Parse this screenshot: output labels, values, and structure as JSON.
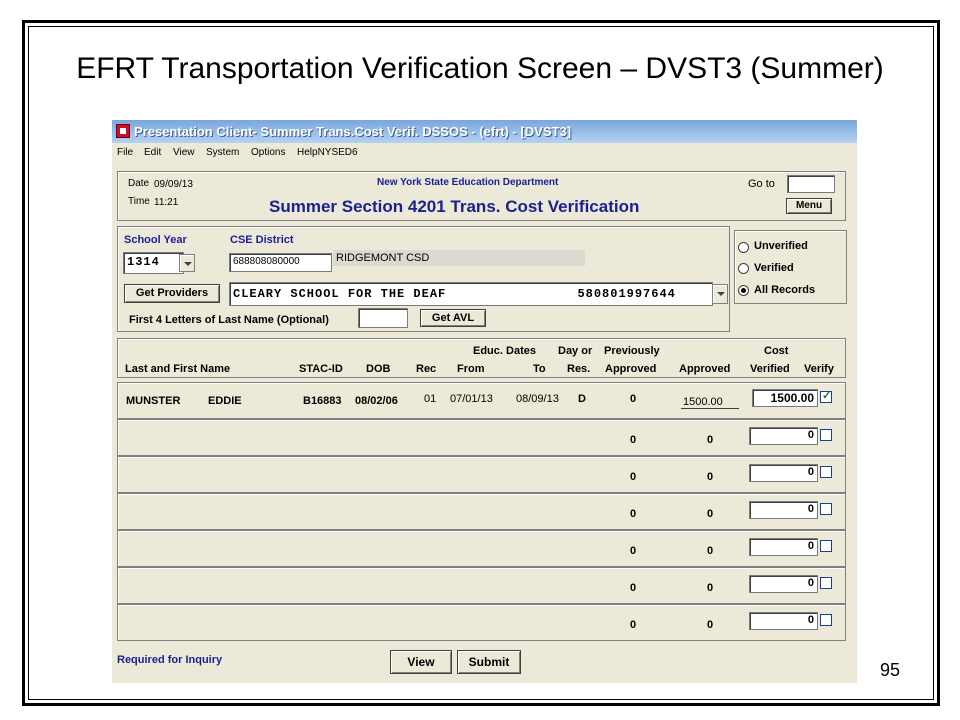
{
  "slide": {
    "title": "EFRT Transportation Verification Screen – DVST3 (Summer)",
    "page_number": "95"
  },
  "window": {
    "title": "Presentation Client- Summer Trans.Cost Verif. DSSOS - (efrt) - [DVST3]",
    "menu": [
      "File",
      "Edit",
      "View",
      "System",
      "Options",
      "HelpNYSED6"
    ]
  },
  "header": {
    "date_label": "Date",
    "date_value": "09/09/13",
    "time_label": "Time",
    "time_value": "11:21",
    "department": "New York State Education Department",
    "screen_title": "Summer Section 4201 Trans. Cost Verification",
    "goto_label": "Go to",
    "goto_value": "",
    "menu_button": "Menu"
  },
  "filters": {
    "school_year_label": "School Year",
    "school_year_value": "1314",
    "cse_district_label": "CSE District",
    "cse_district_code": "688808080000",
    "cse_district_name": "RIDGEMONT CSD",
    "get_providers_button": "Get Providers",
    "provider_value": "CLEARY SCHOOL FOR THE DEAF                580801997644",
    "last_name_label": "First 4 Letters of Last Name (Optional)",
    "last_name_value": "",
    "get_avl_button": "Get AVL",
    "record_filter": [
      {
        "label": "Unverified",
        "selected": false
      },
      {
        "label": "Verified",
        "selected": false
      },
      {
        "label": "All Records",
        "selected": true
      }
    ]
  },
  "table": {
    "group_headers": {
      "educ_dates": "Educ. Dates",
      "day_or": "Day or",
      "previously": "Previously",
      "cost": "Cost"
    },
    "columns": {
      "name": "Last and First Name",
      "stac_id": "STAC-ID",
      "dob": "DOB",
      "rec": "Rec",
      "from": "From",
      "to": "To",
      "res": "Res.",
      "prev_approved": "Approved",
      "approved": "Approved",
      "verified": "Verified",
      "verify": "Verify"
    },
    "rows": [
      {
        "last": "MUNSTER",
        "first": "EDDIE",
        "stac_id": "B16883",
        "dob": "08/02/06",
        "rec": "01",
        "from": "07/01/13",
        "to": "08/09/13",
        "res": "D",
        "prev_approved": "0",
        "approved": "1500.00",
        "cost_verified": "1500.00",
        "verify": true
      },
      {
        "last": "",
        "first": "",
        "stac_id": "",
        "dob": "",
        "rec": "",
        "from": "",
        "to": "",
        "res": "",
        "prev_approved": "0",
        "approved": "0",
        "cost_verified": "0",
        "verify": false
      },
      {
        "last": "",
        "first": "",
        "stac_id": "",
        "dob": "",
        "rec": "",
        "from": "",
        "to": "",
        "res": "",
        "prev_approved": "0",
        "approved": "0",
        "cost_verified": "0",
        "verify": false
      },
      {
        "last": "",
        "first": "",
        "stac_id": "",
        "dob": "",
        "rec": "",
        "from": "",
        "to": "",
        "res": "",
        "prev_approved": "0",
        "approved": "0",
        "cost_verified": "0",
        "verify": false
      },
      {
        "last": "",
        "first": "",
        "stac_id": "",
        "dob": "",
        "rec": "",
        "from": "",
        "to": "",
        "res": "",
        "prev_approved": "0",
        "approved": "0",
        "cost_verified": "0",
        "verify": false
      },
      {
        "last": "",
        "first": "",
        "stac_id": "",
        "dob": "",
        "rec": "",
        "from": "",
        "to": "",
        "res": "",
        "prev_approved": "0",
        "approved": "0",
        "cost_verified": "0",
        "verify": false
      },
      {
        "last": "",
        "first": "",
        "stac_id": "",
        "dob": "",
        "rec": "",
        "from": "",
        "to": "",
        "res": "",
        "prev_approved": "0",
        "approved": "0",
        "cost_verified": "0",
        "verify": false
      }
    ]
  },
  "footer": {
    "required_note": "Required for Inquiry",
    "view_button": "View",
    "submit_button": "Submit"
  },
  "colors": {
    "title_blue": "#1b1f8f",
    "window_bg": "#ece9d8",
    "titlebar": "#7aa6dd"
  }
}
